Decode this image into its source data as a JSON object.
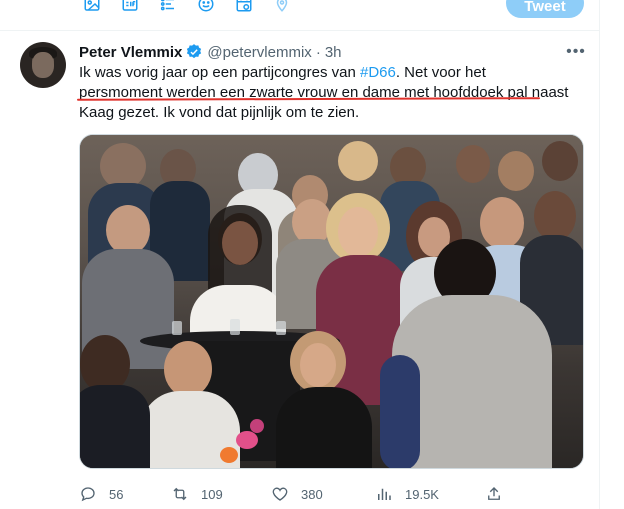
{
  "composer": {
    "tweet_button": "Tweet",
    "icons": [
      "image-icon",
      "gif-icon",
      "poll-icon",
      "emoji-icon",
      "schedule-icon",
      "location-icon"
    ]
  },
  "tweet": {
    "author_name": "Peter Vlemmix",
    "handle": "@petervlemmix",
    "separator": "·",
    "time": "3h",
    "text": {
      "line1_prefix": "Ik was vorig jaar op een partijcongres van ",
      "hashtag": "#D66",
      "line1_suffix": ". Net voor het",
      "line2_underlined": "persmoment werden een zwarte vrouw en dame met hoofddoek pal",
      "line2_suffix": " naast",
      "line3": "Kaag gezet. Ik vond dat pijnlijk om te zien."
    },
    "actions": {
      "replies": "56",
      "retweets": "109",
      "likes": "380",
      "views": "19.5K"
    }
  },
  "colors": {
    "accent": "#1d9bf0",
    "tweet_button_disabled": "#8ecdf8",
    "secondary_text": "#536471",
    "annotation_underline": "#e0312b"
  }
}
